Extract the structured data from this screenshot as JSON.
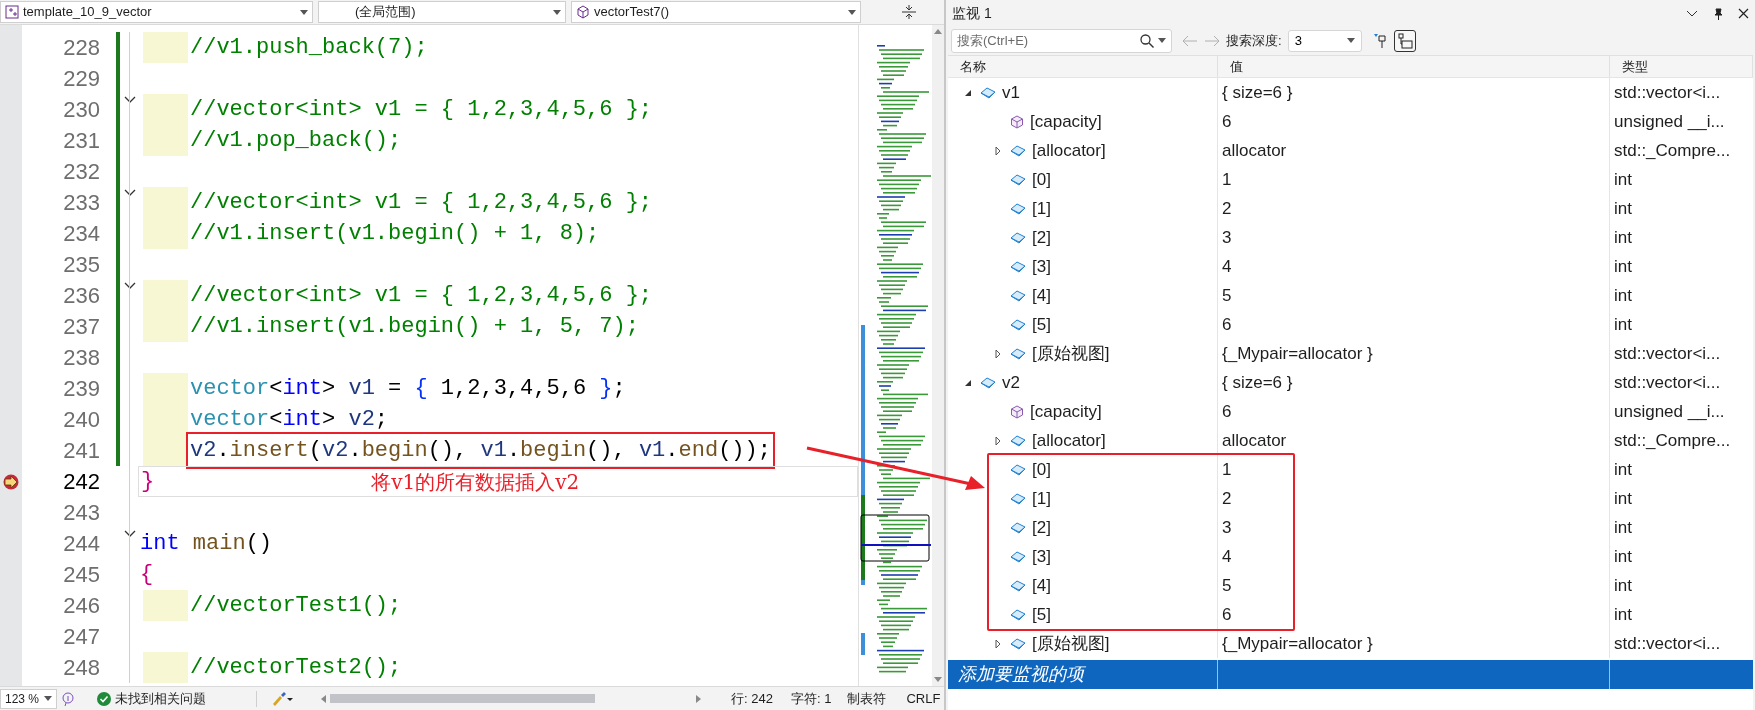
{
  "editor": {
    "file_dropdown": "template_10_9_vector",
    "scope_dropdown": "(全局范围)",
    "function_dropdown": "vectorTest7()",
    "lines": [
      {
        "number": "228",
        "changed": true,
        "fold": false,
        "indented": true,
        "tokens": [
          {
            "text": "//v1.push_back(7);",
            "kind": "comment"
          }
        ]
      },
      {
        "number": "229",
        "changed": true,
        "fold": false,
        "indented": false
      },
      {
        "number": "230",
        "changed": true,
        "fold": true,
        "indented": true,
        "tokens": [
          {
            "text": "//vector<int> v1 = { 1,2,3,4,5,6 };",
            "kind": "comment"
          }
        ]
      },
      {
        "number": "231",
        "changed": true,
        "fold": false,
        "indented": true,
        "tokens": [
          {
            "text": "//v1.pop_back();",
            "kind": "comment"
          }
        ]
      },
      {
        "number": "232",
        "changed": true,
        "fold": false,
        "indented": false
      },
      {
        "number": "233",
        "changed": true,
        "fold": true,
        "indented": true,
        "tokens": [
          {
            "text": "//vector<int> v1 = { 1,2,3,4,5,6 };",
            "kind": "comment"
          }
        ]
      },
      {
        "number": "234",
        "changed": true,
        "fold": false,
        "indented": true,
        "tokens": [
          {
            "text": "//v1.insert(v1.begin() + 1, 8);",
            "kind": "comment"
          }
        ]
      },
      {
        "number": "235",
        "changed": true,
        "fold": false,
        "indented": false
      },
      {
        "number": "236",
        "changed": true,
        "fold": true,
        "indented": true,
        "tokens": [
          {
            "text": "//vector<int> v1 = { 1,2,3,4,5,6 };",
            "kind": "comment"
          }
        ]
      },
      {
        "number": "237",
        "changed": true,
        "fold": false,
        "indented": true,
        "tokens": [
          {
            "text": "//v1.insert(v1.begin() + 1, 5, 7);",
            "kind": "comment"
          }
        ]
      },
      {
        "number": "238",
        "changed": true,
        "fold": false,
        "indented": false
      },
      {
        "number": "239",
        "changed": true,
        "fold": false,
        "indented": true,
        "tokens": [
          {
            "text": "vector",
            "kind": "type"
          },
          {
            "text": "<",
            "kind": "punct"
          },
          {
            "text": "int",
            "kind": "keyword"
          },
          {
            "text": "> ",
            "kind": "punct"
          },
          {
            "text": "v1",
            "kind": "var"
          },
          {
            "text": " = ",
            "kind": "punct"
          },
          {
            "text": "{",
            "kind": "brace"
          },
          {
            "text": " 1,2,3,4,5,6 ",
            "kind": "punct"
          },
          {
            "text": "}",
            "kind": "brace"
          },
          {
            "text": ";",
            "kind": "punct"
          }
        ]
      },
      {
        "number": "240",
        "changed": true,
        "fold": false,
        "indented": true,
        "tokens": [
          {
            "text": "vector",
            "kind": "type"
          },
          {
            "text": "<",
            "kind": "punct"
          },
          {
            "text": "int",
            "kind": "keyword"
          },
          {
            "text": "> ",
            "kind": "punct"
          },
          {
            "text": "v2",
            "kind": "var"
          },
          {
            "text": ";",
            "kind": "punct"
          }
        ]
      },
      {
        "number": "241",
        "changed": true,
        "fold": false,
        "indented": true,
        "boxed": true,
        "tokens": [
          {
            "text": "v2",
            "kind": "var"
          },
          {
            "text": ".",
            "kind": "punct"
          },
          {
            "text": "insert",
            "kind": "func"
          },
          {
            "text": "(",
            "kind": "punct"
          },
          {
            "text": "v2",
            "kind": "var"
          },
          {
            "text": ".",
            "kind": "punct"
          },
          {
            "text": "begin",
            "kind": "func"
          },
          {
            "text": "(), ",
            "kind": "punct"
          },
          {
            "text": "v1",
            "kind": "var"
          },
          {
            "text": ".",
            "kind": "punct"
          },
          {
            "text": "begin",
            "kind": "func"
          },
          {
            "text": "(), ",
            "kind": "punct"
          },
          {
            "text": "v1",
            "kind": "var"
          },
          {
            "text": ".",
            "kind": "punct"
          },
          {
            "text": "end",
            "kind": "func"
          },
          {
            "text": "());",
            "kind": "punct"
          }
        ]
      },
      {
        "number": "242",
        "changed": false,
        "fold": false,
        "indented": false,
        "current": true,
        "note": "将v1的所有数据插入v2",
        "tokens": [
          {
            "text": "}",
            "kind": "pink"
          }
        ]
      },
      {
        "number": "243",
        "changed": false,
        "fold": false,
        "indented": false
      },
      {
        "number": "244",
        "changed": false,
        "fold": true,
        "indented": false,
        "tokens": [
          {
            "text": "int",
            "kind": "keyword"
          },
          {
            "text": " main",
            "kind": "func"
          },
          {
            "text": "()",
            "kind": "punct"
          }
        ]
      },
      {
        "number": "245",
        "changed": false,
        "fold": false,
        "indented": false,
        "tokens": [
          {
            "text": "{",
            "kind": "pink"
          }
        ]
      },
      {
        "number": "246",
        "changed": false,
        "fold": false,
        "indented": true,
        "tokens": [
          {
            "text": "//vectorTest1();",
            "kind": "comment"
          }
        ]
      },
      {
        "number": "247",
        "changed": false,
        "fold": false,
        "indented": false
      },
      {
        "number": "248",
        "changed": false,
        "fold": false,
        "indented": true,
        "tokens": [
          {
            "text": "//vectorTest2();",
            "kind": "comment"
          }
        ]
      }
    ]
  },
  "status_bar": {
    "zoom": "123 %",
    "issues": "未找到相关问题",
    "line": "行: 242",
    "char": "字符: 1",
    "indent": "制表符",
    "eol": "CRLF"
  },
  "watch": {
    "title": "监视 1",
    "search_placeholder": "搜索(Ctrl+E)",
    "depth_label": "搜索深度:",
    "depth": "3",
    "columns": [
      "名称",
      "值",
      "类型"
    ],
    "items": [
      {
        "name": "v1",
        "value": "{ size=6 }",
        "type": "std::vector<i...",
        "kind": "field",
        "expanded": true,
        "children": [
          {
            "name": "[capacity]",
            "value": "6",
            "type": "unsigned __i...",
            "kind": "property"
          },
          {
            "name": "[allocator]",
            "value": "allocator",
            "type": "std::_Compre...",
            "kind": "field",
            "expanded": false
          },
          {
            "name": "[0]",
            "value": "1",
            "type": "int",
            "kind": "field",
            "marked": false
          },
          {
            "name": "[1]",
            "value": "2",
            "type": "int",
            "kind": "field",
            "marked": false
          },
          {
            "name": "[2]",
            "value": "3",
            "type": "int",
            "kind": "field",
            "marked": false
          },
          {
            "name": "[3]",
            "value": "4",
            "type": "int",
            "kind": "field",
            "marked": false
          },
          {
            "name": "[4]",
            "value": "5",
            "type": "int",
            "kind": "field",
            "marked": false
          },
          {
            "name": "[5]",
            "value": "6",
            "type": "int",
            "kind": "field",
            "marked": false
          },
          {
            "name": "[原始视图]",
            "value": "{_Mypair=allocator }",
            "type": "std::vector<i...",
            "kind": "field",
            "expanded": false
          }
        ]
      },
      {
        "name": "v2",
        "value": "{ size=6 }",
        "type": "std::vector<i...",
        "kind": "field",
        "expanded": true,
        "children": [
          {
            "name": "[capacity]",
            "value": "6",
            "type": "unsigned __i...",
            "kind": "property"
          },
          {
            "name": "[allocator]",
            "value": "allocator",
            "type": "std::_Compre...",
            "kind": "field",
            "expanded": false
          },
          {
            "name": "[0]",
            "value": "1",
            "type": "int",
            "kind": "field",
            "marked": true
          },
          {
            "name": "[1]",
            "value": "2",
            "type": "int",
            "kind": "field",
            "marked": true
          },
          {
            "name": "[2]",
            "value": "3",
            "type": "int",
            "kind": "field",
            "marked": true
          },
          {
            "name": "[3]",
            "value": "4",
            "type": "int",
            "kind": "field",
            "marked": true
          },
          {
            "name": "[4]",
            "value": "5",
            "type": "int",
            "kind": "field",
            "marked": true
          },
          {
            "name": "[5]",
            "value": "6",
            "type": "int",
            "kind": "field",
            "marked": true
          },
          {
            "name": "[原始视图]",
            "value": "{_Mypair=allocator }",
            "type": "std::vector<i...",
            "kind": "field",
            "expanded": false
          }
        ]
      }
    ],
    "add_item": {
      "placeholder": "添加要监视的项",
      "selected": true
    }
  }
}
